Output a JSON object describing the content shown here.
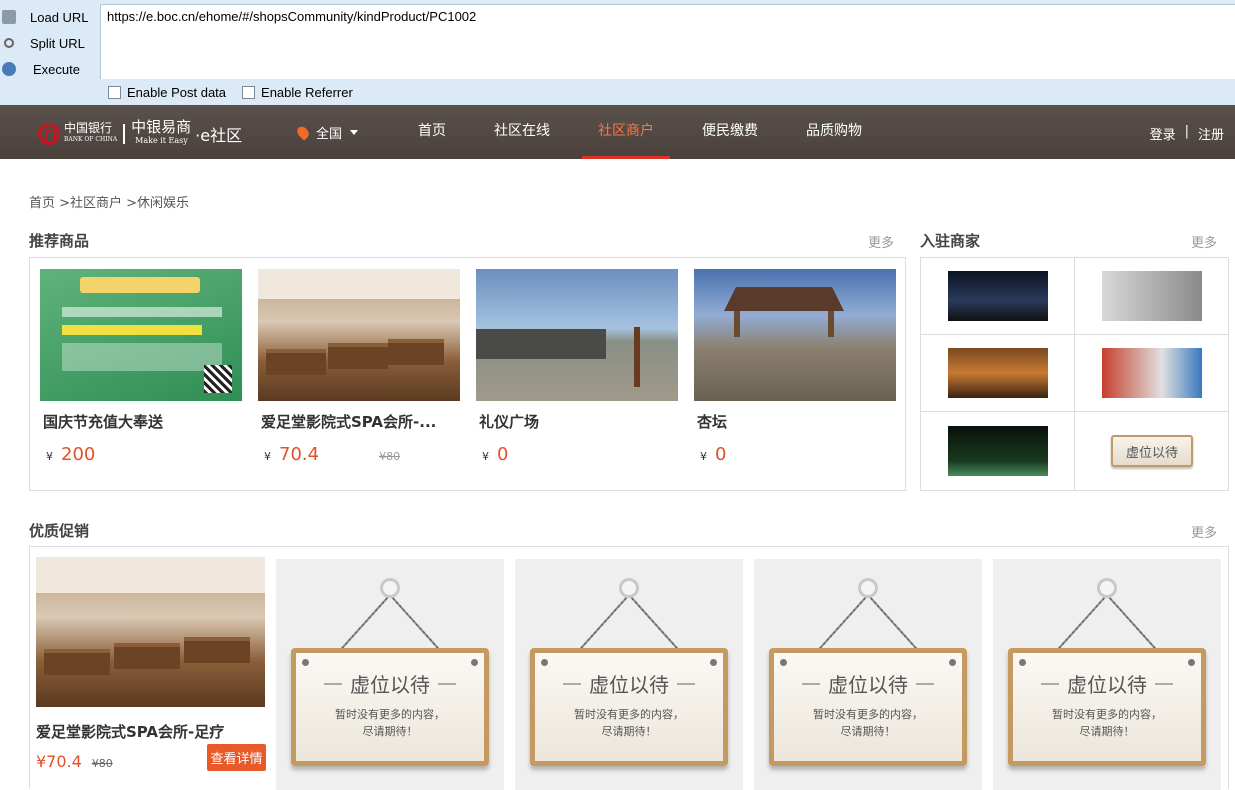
{
  "hackbar": {
    "load_url": "Load URL",
    "split_url": "Split URL",
    "execute": "Execute",
    "url": "https://e.boc.cn/ehome/#/shopsCommunity/kindProduct/PC1002",
    "enable_post": "Enable Post data",
    "enable_referrer": "Enable Referrer"
  },
  "nav": {
    "logo_boc": "中国银行",
    "logo_boc_en": "BANK OF CHINA",
    "logo_main": "中银易商",
    "logo_main_en": "Make it Easy",
    "logo_sub": "·e社区",
    "location": "全国",
    "menu": [
      "首页",
      "社区在线",
      "社区商户",
      "便民缴费",
      "品质购物"
    ],
    "active_index": 2,
    "login": "登录",
    "separator": "|",
    "register": "注册"
  },
  "breadcrumb": "首页 >社区商户 >休闲娱乐",
  "recommended": {
    "title": "推荐商品",
    "more": "更多",
    "items": [
      {
        "name": "国庆节充值大奉送",
        "currency": "¥",
        "price": "200",
        "old_price": ""
      },
      {
        "name": "爱足堂影院式SPA会所-...",
        "currency": "¥",
        "price": "70.4",
        "old_price": "¥80"
      },
      {
        "name": "礼仪广场",
        "currency": "¥",
        "price": "0",
        "old_price": ""
      },
      {
        "name": "杏坛",
        "currency": "¥",
        "price": "0",
        "old_price": ""
      }
    ]
  },
  "merchants": {
    "title": "入驻商家",
    "more": "更多",
    "placeholder": "虚位以待"
  },
  "promotions": {
    "title": "优质促销",
    "more": "更多",
    "card": {
      "name": "爱足堂影院式SPA会所-足疗",
      "price": "¥70.4",
      "old_price": "¥80",
      "button": "查看详情"
    },
    "placeholder_title": "虚位以待",
    "placeholder_line1": "暂时没有更多的内容，",
    "placeholder_line2": "尽请期待！"
  }
}
